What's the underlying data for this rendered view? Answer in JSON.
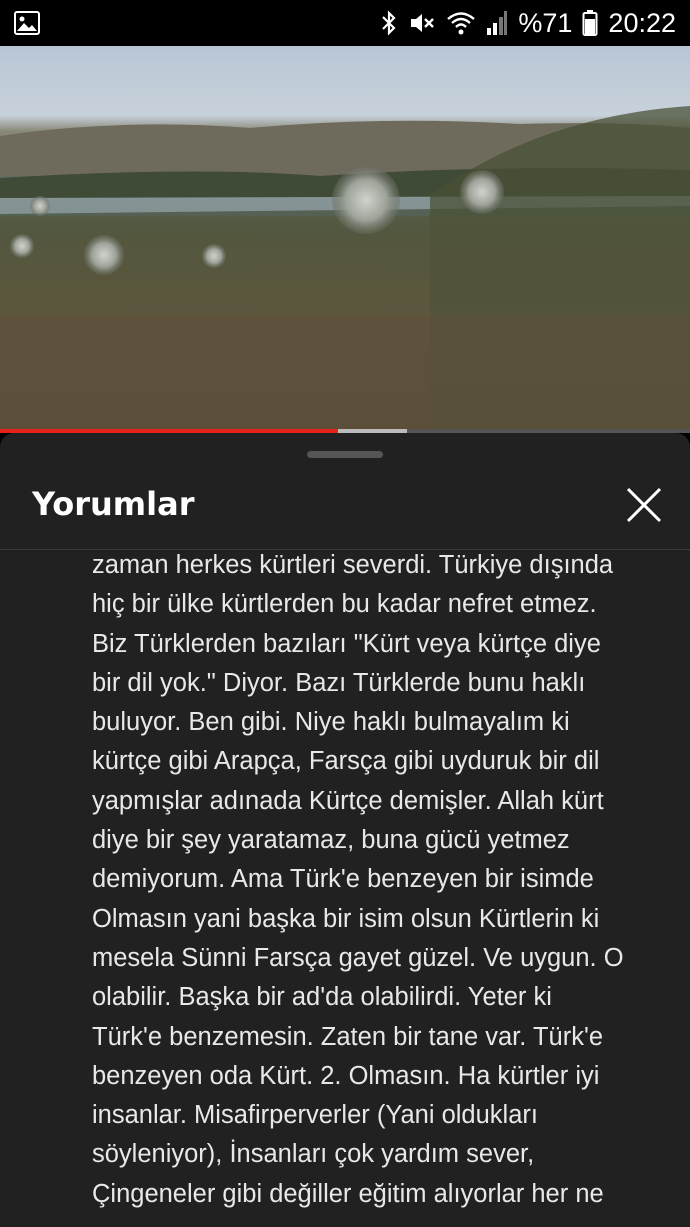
{
  "status_bar": {
    "battery_text": "%71",
    "time": "20:22",
    "icons": [
      "gallery-icon",
      "bluetooth-icon",
      "mute-icon",
      "wifi-icon",
      "signal-icon",
      "battery-icon"
    ]
  },
  "video": {
    "progress_played_fraction": 0.49,
    "progress_buffered_fraction": 0.59,
    "colors": {
      "played": "#e62117",
      "buffered": "#bbbbbb",
      "track": "#555555"
    }
  },
  "sheet": {
    "title": "Yorumlar",
    "close_icon": "close-icon",
    "comment_lines": [
      "zaman herkes kürtleri severdi. Türkiye dışında",
      "hiç bir ülke kürtlerden bu kadar nefret etmez.",
      "Biz Türklerden bazıları  \"Kürt veya kürtçe diye",
      "bir dil yok.\" Diyor. Bazı Türklerde bunu haklı",
      "buluyor. Ben gibi. Niye haklı bulmayalım ki",
      "kürtçe gibi Arapça, Farsça gibi uyduruk bir dil",
      "yapmışlar adınada Kürtçe demişler. Allah kürt",
      "diye bir şey yaratamaz, buna gücü yetmez",
      "demiyorum. Ama Türk'e benzeyen bir isimde",
      "Olmasın yani başka bir isim olsun Kürtlerin ki",
      "mesela Sünni Farsça gayet güzel. Ve uygun. O",
      "olabilir. Başka bir ad'da olabilirdi. Yeter ki",
      "Türk'e benzemesin. Zaten bir tane var. Türk'e",
      "benzeyen oda Kürt. 2. Olmasın. Ha kürtler iyi",
      "insanlar. Misafirperverler (Yani oldukları",
      "söyleniyor), İnsanları çok yardım sever,",
      "Çingeneler gibi değiller eğitim alıyorlar her ne"
    ]
  }
}
